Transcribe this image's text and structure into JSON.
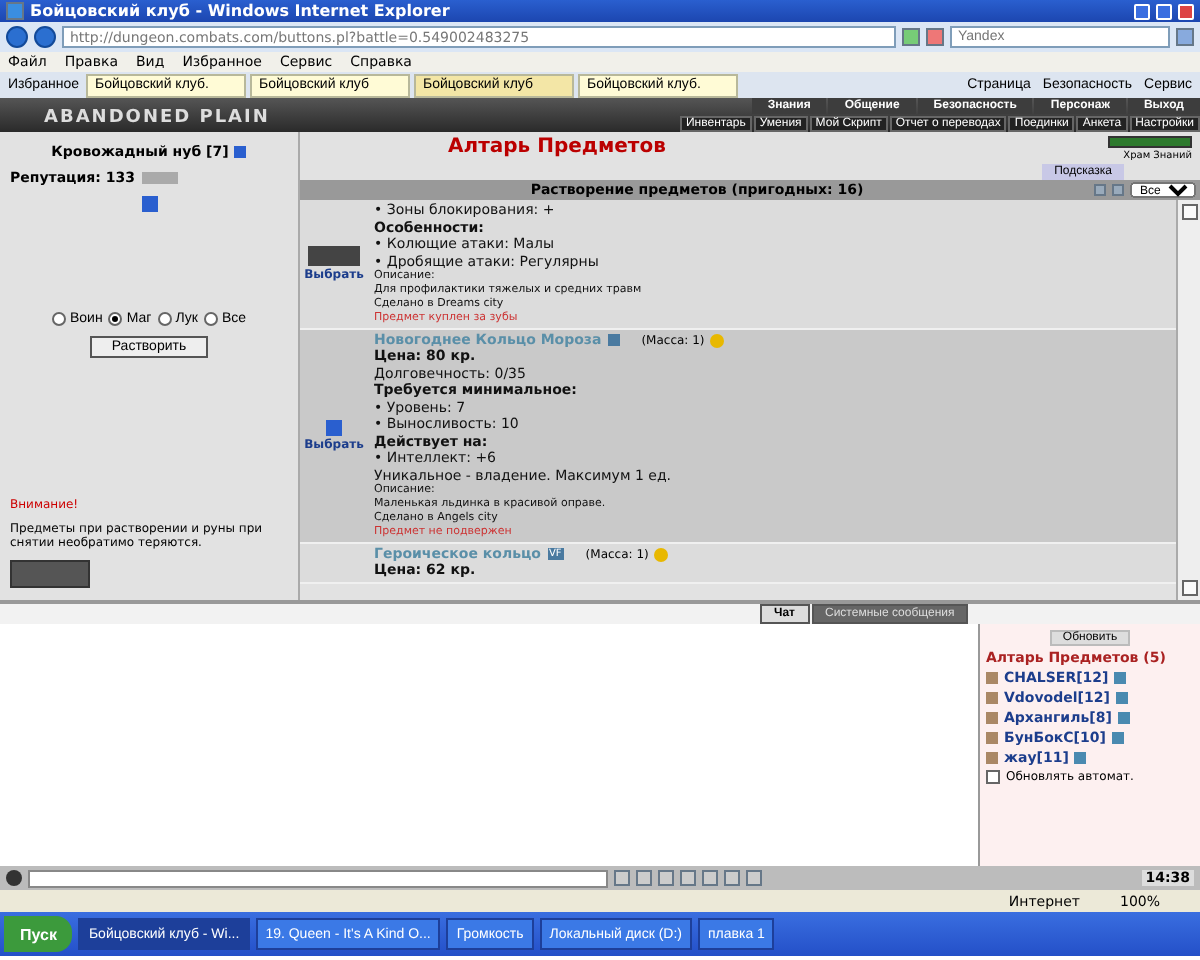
{
  "window": {
    "title": "Бойцовский клуб - Windows Internet Explorer"
  },
  "address_bar": {
    "url": "http://dungeon.combats.com/buttons.pl?battle=0.549002483275",
    "search_placeholder": "Yandex"
  },
  "menu": [
    "Файл",
    "Правка",
    "Вид",
    "Избранное",
    "Сервис",
    "Справка"
  ],
  "favorites": {
    "label": "Избранное"
  },
  "tabs": [
    {
      "label": "Бойцовский клуб.",
      "selected": false
    },
    {
      "label": "Бойцовский клуб",
      "selected": false
    },
    {
      "label": "Бойцовский клуб",
      "selected": true
    },
    {
      "label": "Бойцовский клуб.",
      "selected": false
    }
  ],
  "tools": [
    "Страница",
    "Безопасность",
    "Сервис"
  ],
  "game_header": {
    "logo": "ABANDONED PLAIN",
    "nav_top": [
      "Знания",
      "Общение",
      "Безопасность",
      "Персонаж",
      "Выход"
    ],
    "nav_bottom": [
      "Инвентарь",
      "Умения",
      "Мой Скрипт",
      "Отчет о переводах",
      "Поединки",
      "Анкета",
      "Настройки"
    ]
  },
  "character": {
    "name": "Кровожадный нуб",
    "level": "[7]",
    "reputation": "Репутация: 133",
    "filters": [
      {
        "label": "Воин",
        "selected": false
      },
      {
        "label": "Маг",
        "selected": true
      },
      {
        "label": "Лук",
        "selected": false
      },
      {
        "label": "Все",
        "selected": false
      }
    ],
    "button": "Растворить",
    "warning_title": "Внимание!",
    "warning": "Предметы при растворении и руны при снятии необратимо теряются."
  },
  "altar": {
    "title": "Алтарь Предметов",
    "location": "Храм Знаний",
    "hint_button": "Подсказка",
    "list_title": "Растворение предметов (пригодных: 16)",
    "filter": "Все",
    "items": [
      {
        "selected": false,
        "select_label": "Выбрать",
        "lines": [
          {
            "kind": "normal",
            "text": "• Зоны блокирования: +"
          },
          {
            "kind": "bold",
            "text": "Особенности:"
          },
          {
            "kind": "normal",
            "text": "• Колющие атаки: Малы"
          },
          {
            "kind": "normal",
            "text": "• Дробящие атаки: Регулярны"
          },
          {
            "kind": "small",
            "text": "Описание:"
          },
          {
            "kind": "small",
            "text": "Для профилактики тяжелых и средних травм"
          },
          {
            "kind": "small",
            "text": "Сделано в Dreams city"
          },
          {
            "kind": "note",
            "text": "Предмет куплен за зубы"
          }
        ]
      },
      {
        "selected": true,
        "name": "Новогоднее Кольцо Мороза",
        "mass": "(Масса: 1)",
        "select_label": "Выбрать",
        "lines": [
          {
            "kind": "bold",
            "text": "Цена: 80 кр."
          },
          {
            "kind": "normal",
            "text": "Долговечность: 0/35"
          },
          {
            "kind": "bold",
            "text": "Требуется минимальное:"
          },
          {
            "kind": "normal",
            "text": "• Уровень: 7"
          },
          {
            "kind": "normal",
            "text": "• Выносливость: 10"
          },
          {
            "kind": "bold",
            "text": "Действует на:"
          },
          {
            "kind": "normal",
            "text": "• Интеллект: +6"
          },
          {
            "kind": "normal",
            "text": "Уникальное - владение. Максимум 1 ед."
          },
          {
            "kind": "small",
            "text": "Описание:"
          },
          {
            "kind": "small",
            "text": "Маленькая льдинка в красивой оправе."
          },
          {
            "kind": "small",
            "text": "Сделано в Angels city"
          },
          {
            "kind": "note",
            "text": "Предмет не подвержен"
          }
        ]
      },
      {
        "selected": false,
        "name": "Героическое кольцо",
        "badge": "VF",
        "mass": "(Масса: 1)",
        "lines": [
          {
            "kind": "bold",
            "text": "Цена: 62 кр."
          }
        ]
      }
    ]
  },
  "chat": {
    "tabs": [
      {
        "label": "Чат",
        "selected": true
      },
      {
        "label": "Системные сообщения",
        "selected": false
      }
    ]
  },
  "online": {
    "refresh": "Обновить",
    "title": "Алтарь Предметов (5)",
    "users": [
      {
        "name": "CHALSER",
        "level": "[12]"
      },
      {
        "name": "Vdovodel",
        "level": "[12]"
      },
      {
        "name": "Архангиль",
        "level": "[8]"
      },
      {
        "name": "БунБокС",
        "level": "[10]"
      },
      {
        "name": "жау",
        "level": "[11]"
      }
    ],
    "auto_refresh": {
      "label": "Обновлять автомат.",
      "checked": false
    }
  },
  "clock": "14:38",
  "status_bar": {
    "zone": "Интернет",
    "zoom": "100%"
  },
  "taskbar": {
    "start": "Пуск",
    "tasks": [
      {
        "label": "Бойцовский клуб - Wi...",
        "selected": true
      },
      {
        "label": "19. Queen - It's A Kind O...",
        "selected": false
      },
      {
        "label": "Громкость",
        "selected": false
      },
      {
        "label": "Локальный диск (D:)",
        "selected": false
      },
      {
        "label": "плавка 1",
        "selected": false
      }
    ]
  }
}
